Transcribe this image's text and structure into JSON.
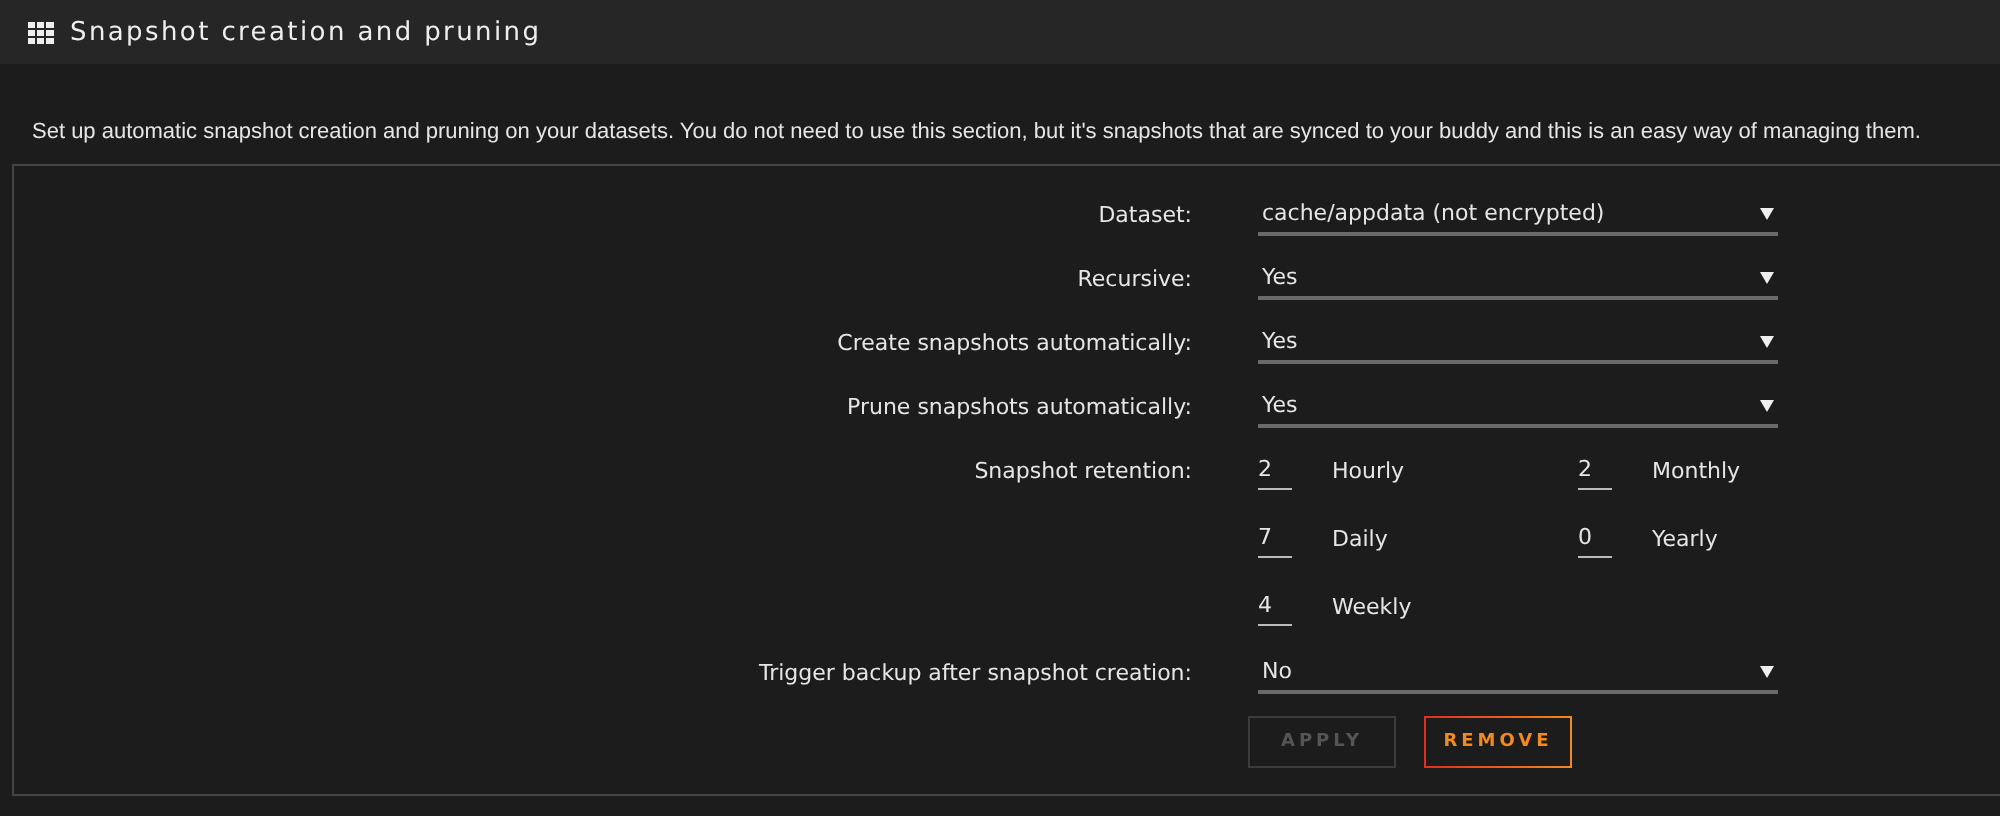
{
  "header": {
    "title": "Snapshot creation and pruning"
  },
  "description": "Set up automatic snapshot creation and pruning on your datasets. You do not need to use this section, but it's snapshots that are synced to your buddy and this is an easy way of managing them.",
  "fields": [
    {
      "kind": "select",
      "label": "Dataset:",
      "value": "cache/appdata (not encrypted)"
    },
    {
      "kind": "select",
      "label": "Recursive:",
      "value": "Yes"
    },
    {
      "kind": "select",
      "label": "Create snapshots automatically:",
      "value": "Yes"
    },
    {
      "kind": "select",
      "label": "Prune snapshots automatically:",
      "value": "Yes"
    },
    {
      "kind": "retention",
      "label": "Snapshot retention:",
      "items": [
        {
          "value": "2",
          "unit": "Hourly"
        },
        {
          "value": "2",
          "unit": "Monthly"
        },
        {
          "value": "7",
          "unit": "Daily"
        },
        {
          "value": "0",
          "unit": "Yearly"
        },
        {
          "value": "4",
          "unit": "Weekly"
        }
      ]
    },
    {
      "kind": "select",
      "label": "Trigger backup after snapshot creation:",
      "value": "No"
    }
  ],
  "buttons": [
    {
      "label": "APPLY",
      "kind": "apply",
      "disabled": true
    },
    {
      "label": "REMOVE",
      "kind": "remove",
      "disabled": false
    }
  ]
}
